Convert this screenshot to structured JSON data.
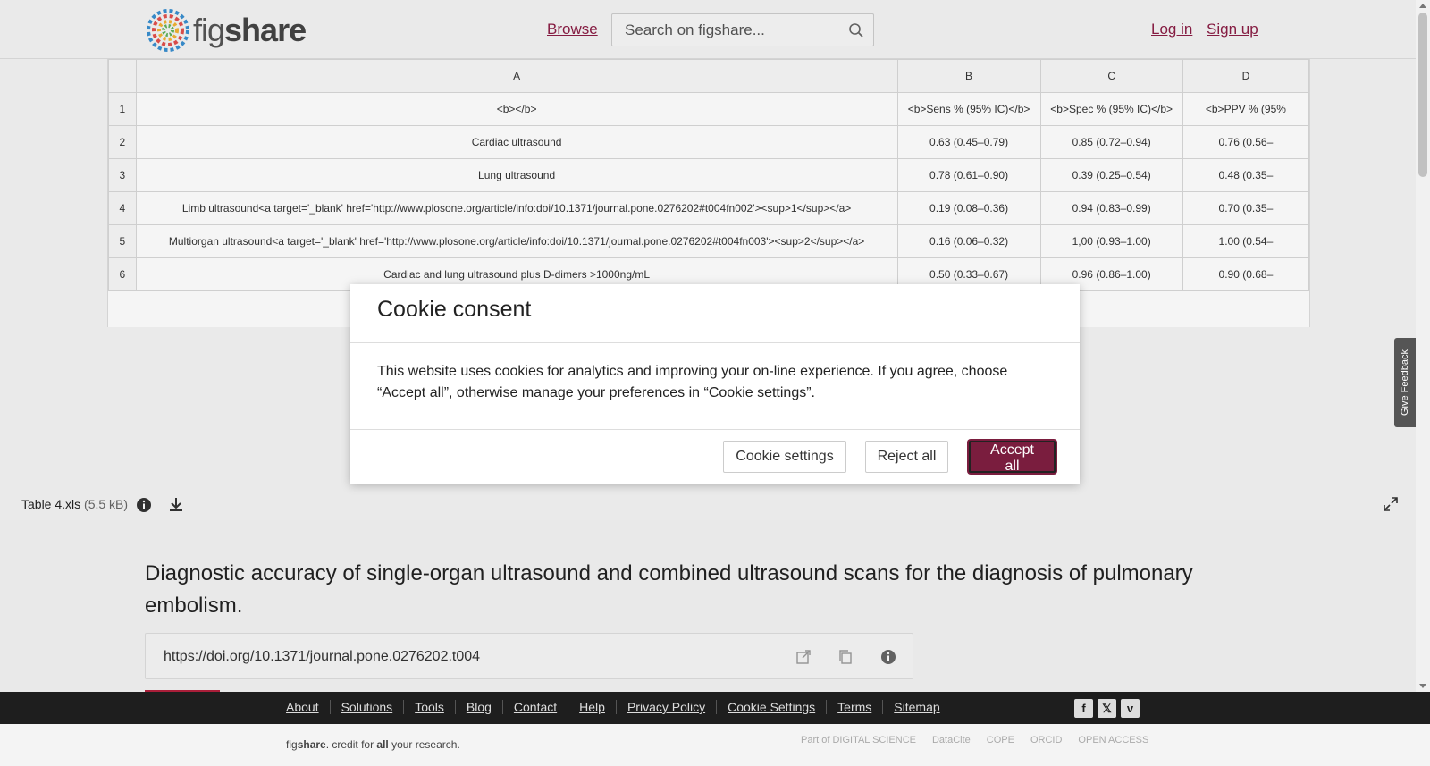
{
  "header": {
    "logo_prefix": "fig",
    "logo_suffix": "share",
    "browse": "Browse",
    "search_placeholder": "Search on figshare...",
    "login": "Log in",
    "signup": "Sign up"
  },
  "sheet": {
    "columns": [
      "A",
      "B",
      "C",
      "D"
    ],
    "rows": [
      {
        "num": "1",
        "a": "<b></b>",
        "b": "<b>Sens % (95% IC)</b>",
        "c": "<b>Spec % (95% IC)</b>",
        "d": "<b>PPV % (95%"
      },
      {
        "num": "2",
        "a": "Cardiac ultrasound",
        "b": "0.63 (0.45–0.79)",
        "c": "0.85 (0.72–0.94)",
        "d": "0.76 (0.56–"
      },
      {
        "num": "3",
        "a": "Lung ultrasound",
        "b": "0.78 (0.61–0.90)",
        "c": "0.39 (0.25–0.54)",
        "d": "0.48 (0.35–"
      },
      {
        "num": "4",
        "a": "Limb ultrasound<a target='_blank' href='http://www.plosone.org/article/info:doi/10.1371/journal.pone.0276202#t004fn002'><sup>1</sup></a>",
        "b": "0.19 (0.08–0.36)",
        "c": "0.94 (0.83–0.99)",
        "d": "0.70 (0.35–"
      },
      {
        "num": "5",
        "a": "Multiorgan ultrasound<a target='_blank' href='http://www.plosone.org/article/info:doi/10.1371/journal.pone.0276202#t004fn003'><sup>2</sup></a>",
        "b": "0.16 (0.06–0.32)",
        "c": "1,00 (0.93–1.00)",
        "d": "1.00 (0.54–"
      },
      {
        "num": "6",
        "a": "Cardiac and lung ultrasound plus D-dimers >1000ng/mL",
        "b": "0.50 (0.33–0.67)",
        "c": "0.96 (0.86–1.00)",
        "d": "0.90 (0.68–"
      }
    ]
  },
  "file": {
    "name": "Table 4.xls",
    "size": "(5.5 kB)"
  },
  "content": {
    "title": "Diagnostic accuracy of single-organ ultrasound and combined ultrasound scans for the diagnosis of pulmonary embolism.",
    "doi": "https://doi.org/10.1371/journal.pone.0276202.t004"
  },
  "modal": {
    "title": "Cookie consent",
    "body": "This website uses cookies for analytics and improving your on-line experience. If you agree, choose “Accept all”, otherwise manage your preferences in “Cookie settings”.",
    "settings": "Cookie settings",
    "reject": "Reject all",
    "accept": "Accept all",
    "accent": "#7a1d3e"
  },
  "feedback": "Give Feedback",
  "footer": {
    "links": [
      "About",
      "Solutions",
      "Tools",
      "Blog",
      "Contact",
      "Help",
      "Privacy Policy",
      "Cookie Settings",
      "Terms",
      "Sitemap"
    ],
    "social": [
      "facebook-icon",
      "x-icon",
      "vimeo-icon"
    ],
    "tagline_fig": "fig",
    "tagline_share": "share",
    "tagline_mid": ". credit for ",
    "tagline_all": "all",
    "tagline_end": " your research.",
    "partners": [
      "Part of DIGITAL SCIENCE",
      "DataCite",
      "COPE",
      "ORCID",
      "OPEN ACCESS"
    ]
  }
}
